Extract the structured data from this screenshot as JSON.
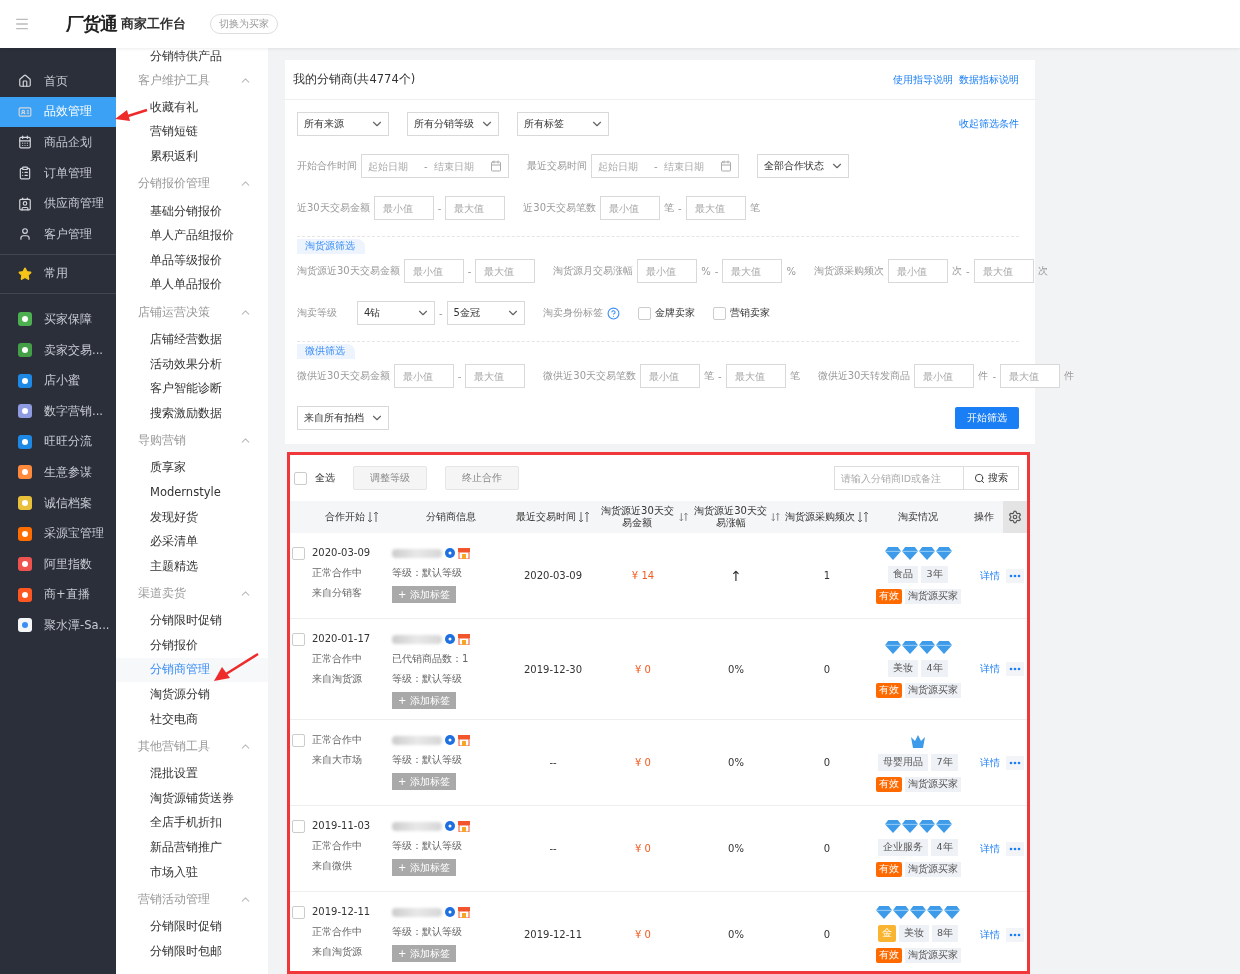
{
  "topbar": {
    "brand": "厂货通",
    "title": "商家工作台",
    "switch_button": "切换为买家"
  },
  "sidebar": {
    "groups": [
      [
        {
          "label": "首页",
          "selected": false
        },
        {
          "label": "品效管理",
          "selected": true
        },
        {
          "label": "商品企划",
          "selected": false
        },
        {
          "label": "订单管理",
          "selected": false
        },
        {
          "label": "供应商管理",
          "selected": false
        },
        {
          "label": "客户管理",
          "selected": false
        }
      ],
      [
        {
          "label": "常用",
          "selected": false
        }
      ],
      [
        {
          "label": "买家保障",
          "selected": false
        },
        {
          "label": "卖家交易...",
          "selected": false
        },
        {
          "label": "店小蜜",
          "selected": false
        },
        {
          "label": "数字营销...",
          "selected": false
        },
        {
          "label": "旺旺分流",
          "selected": false
        },
        {
          "label": "生意参谋",
          "selected": false
        },
        {
          "label": "诚信档案",
          "selected": false
        },
        {
          "label": "采源宝管理",
          "selected": false
        },
        {
          "label": "阿里指数",
          "selected": false
        },
        {
          "label": "商+直播",
          "selected": false
        },
        {
          "label": "聚水潭-Sa...",
          "selected": false
        }
      ]
    ]
  },
  "subnav": {
    "items": [
      {
        "kind": "item",
        "label": "分销特供产品",
        "selected": false
      },
      {
        "kind": "group",
        "label": "客户维护工具",
        "expanded": true,
        "children": [
          {
            "label": "收藏有礼",
            "selected": false
          },
          {
            "label": "营销短链",
            "selected": false
          },
          {
            "label": "累积返利",
            "selected": false
          }
        ]
      },
      {
        "kind": "group",
        "label": "分销报价管理",
        "expanded": true,
        "children": [
          {
            "label": "基础分销报价",
            "selected": false
          },
          {
            "label": "单人产品组报价",
            "selected": false
          },
          {
            "label": "单品等级报价",
            "selected": false
          },
          {
            "label": "单人单品报价",
            "selected": false
          }
        ]
      },
      {
        "kind": "group",
        "label": "店铺运营决策",
        "expanded": true,
        "children": [
          {
            "label": "店铺经营数据",
            "selected": false
          },
          {
            "label": "活动效果分析",
            "selected": false
          },
          {
            "label": "客户智能诊断",
            "selected": false
          },
          {
            "label": "搜索激励数据",
            "selected": false
          }
        ]
      },
      {
        "kind": "group",
        "label": "导购营销",
        "expanded": true,
        "children": [
          {
            "label": "质享家",
            "selected": false
          },
          {
            "label": "Modernstyle",
            "selected": false
          },
          {
            "label": "发现好货",
            "selected": false
          },
          {
            "label": "必采清单",
            "selected": false
          },
          {
            "label": "主题精选",
            "selected": false
          }
        ]
      },
      {
        "kind": "group",
        "label": "渠道卖货",
        "expanded": true,
        "children": [
          {
            "label": "分销限时促销",
            "selected": false
          },
          {
            "label": "分销报价",
            "selected": false
          },
          {
            "label": "分销商管理",
            "selected": true
          },
          {
            "label": "淘货源分销",
            "selected": false
          },
          {
            "label": "社交电商",
            "selected": false
          }
        ]
      },
      {
        "kind": "group",
        "label": "其他营销工具",
        "expanded": true,
        "children": [
          {
            "label": "混批设置",
            "selected": false
          },
          {
            "label": "淘货源铺货送券",
            "selected": false
          },
          {
            "label": "全店手机折扣",
            "selected": false
          },
          {
            "label": "新品营销推广",
            "selected": false
          },
          {
            "label": "市场入驻",
            "selected": false
          }
        ]
      },
      {
        "kind": "group",
        "label": "营销活动管理",
        "expanded": true,
        "children": [
          {
            "label": "分销限时促销",
            "selected": false
          },
          {
            "label": "分销限时包邮",
            "selected": false
          }
        ]
      }
    ]
  },
  "panel": {
    "title": "我的分销商(共4774个)",
    "links": [
      "使用指导说明",
      "数据指标说明"
    ]
  },
  "filters": {
    "blocks": [
      {
        "kind": "row",
        "items": [
          {
            "kind": "select",
            "value": "所有来源"
          },
          {
            "kind": "select",
            "value": "所有分销等级"
          },
          {
            "kind": "select",
            "value": "所有标签"
          },
          {
            "kind": "link",
            "label": "收起筛选条件"
          }
        ]
      },
      {
        "kind": "row",
        "items": [
          {
            "kind": "date_range",
            "label": "开始合作时间",
            "start_placeholder": "起始日期",
            "separator": "-",
            "end_placeholder": "结束日期"
          },
          {
            "kind": "date_range",
            "label": "最近交易时间",
            "start_placeholder": "起始日期",
            "separator": "-",
            "end_placeholder": "结束日期"
          },
          {
            "kind": "select",
            "value": "全部合作状态"
          }
        ]
      },
      {
        "kind": "row",
        "items": [
          {
            "kind": "range",
            "label": "近30天交易金额",
            "min_placeholder": "最小值",
            "separator": "-",
            "max_placeholder": "最大值"
          },
          {
            "kind": "range",
            "label": "近30天交易笔数",
            "min_placeholder": "最小值",
            "min_unit": "笔",
            "separator": "-",
            "max_placeholder": "最大值",
            "max_unit": "笔"
          }
        ]
      },
      {
        "kind": "section",
        "label": "淘货源筛选"
      },
      {
        "kind": "row",
        "items": [
          {
            "kind": "range",
            "label": "淘货源近30天交易金额",
            "min_placeholder": "最小值",
            "separator": "-",
            "max_placeholder": "最大值"
          },
          {
            "kind": "range",
            "label": "淘货源月交易涨幅",
            "min_placeholder": "最小值",
            "min_unit": "%",
            "separator": "-",
            "max_placeholder": "最大值",
            "max_unit": "%"
          },
          {
            "kind": "range",
            "label": "淘货源采购频次",
            "min_placeholder": "最小值",
            "min_unit": "次",
            "separator": "-",
            "max_placeholder": "最大值",
            "max_unit": "次"
          }
        ]
      },
      {
        "kind": "row",
        "items": [
          {
            "kind": "select_range",
            "label": "淘卖等级",
            "from": "4钻",
            "separator": "-",
            "to": "5金冠"
          },
          {
            "kind": "help_label",
            "label": "淘卖身份标签"
          },
          {
            "kind": "checkbox",
            "label": "金牌卖家",
            "checked": false
          },
          {
            "kind": "checkbox",
            "label": "营销卖家",
            "checked": false
          }
        ]
      },
      {
        "kind": "section",
        "label": "微供筛选"
      },
      {
        "kind": "row",
        "items": [
          {
            "kind": "range",
            "label": "微供近30天交易金额",
            "min_placeholder": "最小值",
            "separator": "-",
            "max_placeholder": "最大值"
          },
          {
            "kind": "range",
            "label": "微供近30天交易笔数",
            "min_placeholder": "最小值",
            "min_unit": "笔",
            "separator": "-",
            "max_placeholder": "最大值",
            "max_unit": "笔"
          },
          {
            "kind": "range",
            "label": "微供近30天转发商品",
            "min_placeholder": "最小值",
            "min_unit": "件",
            "separator": "-",
            "max_placeholder": "最大值",
            "max_unit": "件"
          }
        ]
      },
      {
        "kind": "row",
        "items": [
          {
            "kind": "select",
            "value": "来自所有拍档"
          },
          {
            "kind": "button",
            "label": "开始筛选"
          }
        ]
      }
    ]
  },
  "table": {
    "toolbar": {
      "select_all": {
        "label": "全选",
        "checked": false
      },
      "buttons": [
        {
          "label": "调整等级",
          "disabled": true
        },
        {
          "label": "终止合作",
          "disabled": true
        }
      ],
      "search": {
        "placeholder": "请输入分销商ID或备注",
        "button": "搜索"
      }
    },
    "columns": [
      {
        "label": "合作开始",
        "sortable": true
      },
      {
        "label": "分销商信息",
        "sortable": false
      },
      {
        "label": "最近交易时间",
        "sortable": true
      },
      {
        "label": "淘货源近30天交易金额",
        "sortable": true
      },
      {
        "label": "淘货源近30天交易涨幅",
        "sortable": true
      },
      {
        "label": "淘货源采购频次",
        "sortable": true
      },
      {
        "label": "淘卖情况",
        "sortable": false
      },
      {
        "label": "操作",
        "sortable": false
      }
    ],
    "rows": [
      {
        "checked": false,
        "start_date": "2020-03-09",
        "status": "正常合作中",
        "source": "来自分销客",
        "info_lines": [
          "等级：默认等级"
        ],
        "add_tag": "+ 添加标签",
        "last_trade": "2020-03-09",
        "amount": "¥ 14",
        "growth": "↑",
        "frequency": "1",
        "rating": {
          "kind": "diamond",
          "stars": 4
        },
        "category": "食品",
        "years": "3年",
        "validity": "有效",
        "buyer_type": "淘货源买家",
        "detail": "详情"
      },
      {
        "checked": false,
        "start_date": "2020-01-17",
        "status": "正常合作中",
        "source": "来自淘货源",
        "info_lines": [
          "已代销商品数：1",
          "等级：默认等级"
        ],
        "add_tag": "+ 添加标签",
        "last_trade": "2019-12-30",
        "amount": "¥ 0",
        "growth": "0%",
        "frequency": "0",
        "rating": {
          "kind": "diamond",
          "stars": 4
        },
        "category": "美妆",
        "years": "4年",
        "validity": "有效",
        "buyer_type": "淘货源买家",
        "detail": "详情"
      },
      {
        "checked": false,
        "status": "正常合作中",
        "source": "来自大市场",
        "info_lines": [
          "等级：默认等级"
        ],
        "add_tag": "+ 添加标签",
        "last_trade": "--",
        "amount": "¥ 0",
        "growth": "0%",
        "frequency": "0",
        "rating": {
          "kind": "crown"
        },
        "category": "母婴用品",
        "years": "7年",
        "validity": "有效",
        "buyer_type": "淘货源买家",
        "detail": "详情"
      },
      {
        "checked": false,
        "start_date": "2019-11-03",
        "status": "正常合作中",
        "source": "来自微供",
        "info_lines": [
          "等级：默认等级"
        ],
        "add_tag": "+ 添加标签",
        "last_trade": "--",
        "amount": "¥ 0",
        "growth": "0%",
        "frequency": "0",
        "rating": {
          "kind": "diamond",
          "stars": 4
        },
        "category": "企业服务",
        "years": "4年",
        "validity": "有效",
        "buyer_type": "淘货源买家",
        "detail": "详情"
      },
      {
        "checked": false,
        "start_date": "2019-12-11",
        "status": "正常合作中",
        "source": "来自淘货源",
        "info_lines": [
          "等级：默认等级"
        ],
        "add_tag": "+ 添加标签",
        "last_trade": "2019-12-11",
        "amount": "¥ 0",
        "growth": "0%",
        "frequency": "0",
        "rating": {
          "kind": "diamond",
          "stars": 5
        },
        "gold_badge": "金",
        "category": "美妆",
        "years": "8年",
        "validity": "有效",
        "buyer_type": "淘货源买家",
        "detail": "详情"
      }
    ]
  }
}
